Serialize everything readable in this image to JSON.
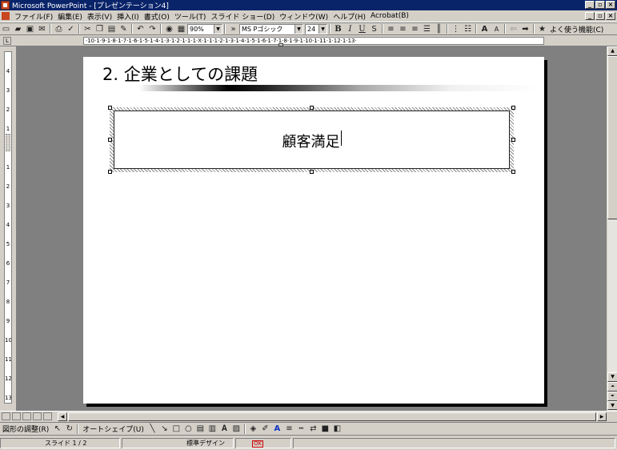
{
  "window": {
    "title": "Microsoft PowerPoint - [プレゼンテーション4]",
    "min_label": "_",
    "restore_label": "3",
    "close_label": "×"
  },
  "menu": {
    "items": [
      "ファイル(F)",
      "編集(E)",
      "表示(V)",
      "挿入(I)",
      "書式(O)",
      "ツール(T)",
      "スライド ショー(D)",
      "ウィンドウ(W)",
      "ヘルプ(H)",
      "Acrobat(B)"
    ]
  },
  "toolbar": {
    "zoom": "90%",
    "font_name": "MS Pゴシック",
    "font_size": "24",
    "bold_label": "B",
    "italic_label": "I",
    "underline_label": "U",
    "shadow_label": "S",
    "favorites_label": "よく使う機能(C)"
  },
  "ruler": {
    "horizontal": "·10·1·9·1·8·1·7·1·6·1·5·1·4·1·3·1·2·1·1·1·X·1·1·1·2·1·3·1·4·1·5·1·6·1·7·1·8·1·9·1·10·1·11·1·12·1·13·",
    "vertical": [
      "4",
      "3",
      "2",
      "1",
      "0",
      "1",
      "2",
      "3",
      "4",
      "5",
      "6",
      "7",
      "8",
      "9",
      "10",
      "11",
      "12",
      "13",
      "14"
    ]
  },
  "slide": {
    "title": "2. 企業としての課題",
    "textbox_text": "顧客満足"
  },
  "drawing": {
    "draw_menu": "図形の調整(R)",
    "autoshapes": "オートシェイプ(U)"
  },
  "status": {
    "slide_indicator": "スライド 1 / 2",
    "design": "標準デザイン",
    "spell": "OK"
  }
}
